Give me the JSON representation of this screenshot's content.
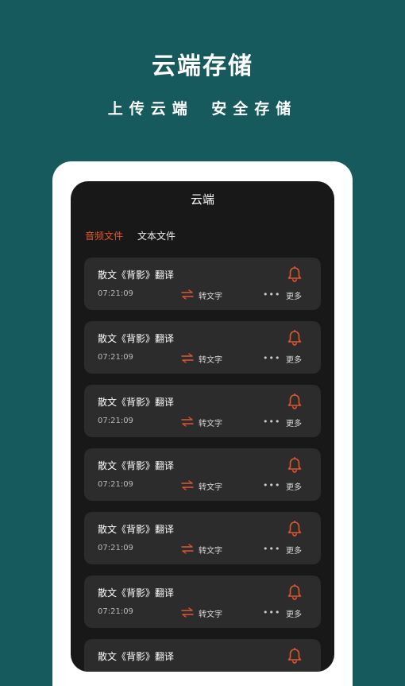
{
  "promo": {
    "title": "云端存储",
    "subtitle": "上传云端  安全存储"
  },
  "screen": {
    "title": "云端",
    "tabs": [
      {
        "label": "音频文件",
        "active": true
      },
      {
        "label": "文本文件",
        "active": false
      }
    ],
    "items": [
      {
        "title": "散文《背影》翻译",
        "time": "07:21:09",
        "convert_label": "转文字",
        "more_label": "更多",
        "dots": "•••"
      },
      {
        "title": "散文《背影》翻译",
        "time": "07:21:09",
        "convert_label": "转文字",
        "more_label": "更多",
        "dots": "•••"
      },
      {
        "title": "散文《背影》翻译",
        "time": "07:21:09",
        "convert_label": "转文字",
        "more_label": "更多",
        "dots": "•••"
      },
      {
        "title": "散文《背影》翻译",
        "time": "07:21:09",
        "convert_label": "转文字",
        "more_label": "更多",
        "dots": "•••"
      },
      {
        "title": "散文《背影》翻译",
        "time": "07:21:09",
        "convert_label": "转文字",
        "more_label": "更多",
        "dots": "•••"
      },
      {
        "title": "散文《背影》翻译",
        "time": "07:21:09",
        "convert_label": "转文字",
        "more_label": "更多",
        "dots": "•••"
      },
      {
        "title": "散文《背影》翻译",
        "time": "",
        "convert_label": "",
        "more_label": "",
        "dots": ""
      }
    ]
  },
  "colors": {
    "background": "#165a5d",
    "screen": "#181818",
    "card": "#2c2c2c",
    "accent": "#e0562f"
  },
  "icons": {
    "bell": "bell-icon",
    "swap": "swap-arrows-icon",
    "more": "more-dots-icon"
  }
}
